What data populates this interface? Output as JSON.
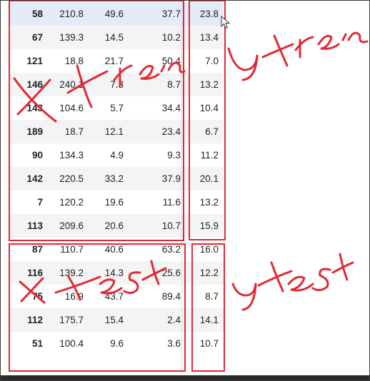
{
  "table": {
    "rows": [
      {
        "index": "58",
        "tv": "210.8",
        "radio": "49.6",
        "newspaper": "37.7",
        "sales": "23.8"
      },
      {
        "index": "67",
        "tv": "139.3",
        "radio": "14.5",
        "newspaper": "10.2",
        "sales": "13.4"
      },
      {
        "index": "121",
        "tv": "18.8",
        "radio": "21.7",
        "newspaper": "50.4",
        "sales": "7.0"
      },
      {
        "index": "146",
        "tv": "240.1",
        "radio": "7.3",
        "newspaper": "8.7",
        "sales": "13.2"
      },
      {
        "index": "143",
        "tv": "104.6",
        "radio": "5.7",
        "newspaper": "34.4",
        "sales": "10.4"
      },
      {
        "index": "189",
        "tv": "18.7",
        "radio": "12.1",
        "newspaper": "23.4",
        "sales": "6.7"
      },
      {
        "index": "90",
        "tv": "134.3",
        "radio": "4.9",
        "newspaper": "9.3",
        "sales": "11.2"
      },
      {
        "index": "142",
        "tv": "220.5",
        "radio": "33.2",
        "newspaper": "37.9",
        "sales": "20.1"
      },
      {
        "index": "7",
        "tv": "120.2",
        "radio": "19.6",
        "newspaper": "11.6",
        "sales": "13.2"
      },
      {
        "index": "113",
        "tv": "209.6",
        "radio": "20.6",
        "newspaper": "10.7",
        "sales": "15.9"
      },
      {
        "index": "87",
        "tv": "110.7",
        "radio": "40.6",
        "newspaper": "63.2",
        "sales": "16.0"
      },
      {
        "index": "116",
        "tv": "139.2",
        "radio": "14.3",
        "newspaper": "25.6",
        "sales": "12.2"
      },
      {
        "index": "75",
        "tv": "16.9",
        "radio": "43.7",
        "newspaper": "89.4",
        "sales": "8.7"
      },
      {
        "index": "112",
        "tv": "175.7",
        "radio": "15.4",
        "newspaper": "2.4",
        "sales": "14.1"
      },
      {
        "index": "51",
        "tv": "100.4",
        "radio": "9.6",
        "newspaper": "3.6",
        "sales": "10.7"
      }
    ],
    "highlighted_row": 0
  },
  "annotations": {
    "x_train": "x-train",
    "y_train": "y-train",
    "x_test": "x-test",
    "y_test": "y-test",
    "ink_color": "#e02a36"
  },
  "icons": [
    "mouse-cursor-icon"
  ]
}
